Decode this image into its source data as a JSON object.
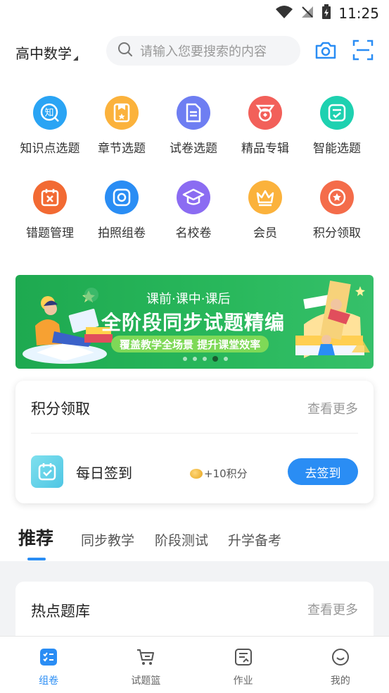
{
  "status_bar": {
    "time": "11:25"
  },
  "header": {
    "subject": "高中数学",
    "search_placeholder": "请输入您要搜索的内容"
  },
  "grid": {
    "row1": [
      {
        "label": "知识点选题",
        "icon": "knowledge-icon",
        "color": "#2aa4f4",
        "glyph": "知"
      },
      {
        "label": "章节选题",
        "icon": "chapter-icon",
        "color": "#fbb23c",
        "glyph": ""
      },
      {
        "label": "试卷选题",
        "icon": "paper-icon",
        "color": "#6e7ef2",
        "glyph": ""
      },
      {
        "label": "精品专辑",
        "icon": "medal-icon",
        "color": "#f2605a",
        "glyph": ""
      },
      {
        "label": "智能选题",
        "icon": "smart-icon",
        "color": "#1ed1b0",
        "glyph": ""
      }
    ],
    "row2": [
      {
        "label": "错题管理",
        "icon": "wrong-question-icon",
        "color": "#f26a33",
        "glyph": ""
      },
      {
        "label": "拍照组卷",
        "icon": "photo-icon",
        "color": "#2a8df4",
        "glyph": ""
      },
      {
        "label": "名校卷",
        "icon": "graduation-cap-icon",
        "color": "#8b6cf2",
        "glyph": ""
      },
      {
        "label": "会员",
        "icon": "crown-icon",
        "color": "#fbb23c",
        "glyph": ""
      },
      {
        "label": "积分领取",
        "icon": "points-icon",
        "color": "#f46c4a",
        "glyph": ""
      }
    ]
  },
  "banner": {
    "line1": "课前·课中·课后",
    "line2": "全阶段同步试题精编",
    "line3": "覆盖教学全场景 提升课堂效率"
  },
  "points_card": {
    "title": "积分领取",
    "more": "查看更多",
    "checkin_label": "每日签到",
    "reward": "+10积分",
    "button": "去签到"
  },
  "tabs": [
    "推荐",
    "同步教学",
    "阶段测试",
    "升学备考"
  ],
  "hot_card": {
    "title": "热点题库",
    "more": "查看更多"
  },
  "bottom_nav": [
    {
      "label": "组卷",
      "icon": "compose-icon",
      "active": true
    },
    {
      "label": "试题篮",
      "icon": "cart-icon",
      "active": false
    },
    {
      "label": "作业",
      "icon": "homework-icon",
      "active": false
    },
    {
      "label": "我的",
      "icon": "profile-icon",
      "active": false
    }
  ],
  "colors": {
    "accent": "#2a8df4",
    "banner_green": "#1ea950"
  }
}
